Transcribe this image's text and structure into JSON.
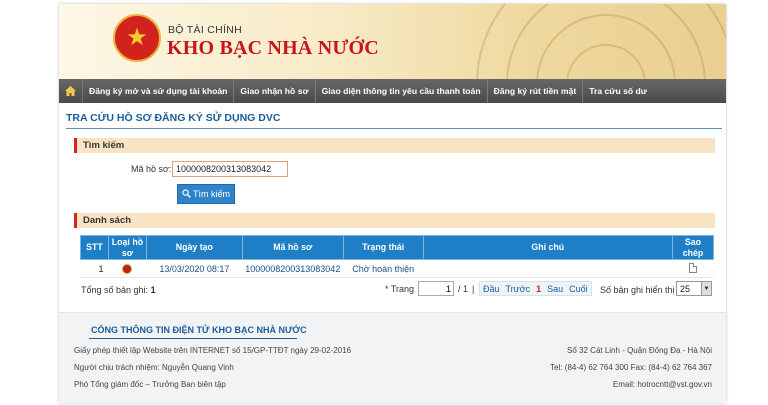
{
  "header": {
    "org_sub": "BỘ TÀI CHÍNH",
    "org_main": "KHO BẠC NHÀ NƯỚC",
    "brand_color": "#c8141b"
  },
  "nav": {
    "home_icon": "home-icon",
    "items": [
      {
        "label": "Đăng ký mở và sử dụng tài khoản"
      },
      {
        "label": "Giao nhận hồ sơ"
      },
      {
        "label": "Giao diện thông tin yêu cầu thanh toán"
      },
      {
        "label": "Đăng ký rút tiền mặt"
      },
      {
        "label": "Tra cứu số dư"
      }
    ]
  },
  "page": {
    "title": "TRA CỨU HỒ SƠ ĐĂNG KÝ SỬ DỤNG DVC"
  },
  "search": {
    "section_label": "Tìm kiếm",
    "field_label": "Mã hồ sơ:",
    "value": "1000008200313083042",
    "button_label": "Tìm kiếm"
  },
  "list": {
    "section_label": "Danh sách",
    "columns": [
      "STT",
      "Loại hồ sơ",
      "Ngày tạo",
      "Mã hồ sơ",
      "Trạng thái",
      "Ghi chú",
      "Sao chép"
    ],
    "rows": [
      {
        "stt": "1",
        "loai_icon": "record-type-icon",
        "ngay_tao": "13/03/2020 08:17",
        "ma_ho_so": "1000008200313083042",
        "trang_thai": "Chờ hoàn thiện",
        "ghi_chu": "",
        "sao_chep_icon": "copy-icon"
      }
    ],
    "total_label": "Tổng số bản ghi:",
    "total_value": "1"
  },
  "pager": {
    "page_label": "* Trang",
    "page_value": "1",
    "page_total": "/ 1",
    "separator": "|",
    "first": "Đầu",
    "prev": "Trước",
    "current": "1",
    "next": "Sau",
    "last": "Cuối",
    "rows_label": "Số bản ghi hiển thị",
    "rows_value": "25"
  },
  "footer": {
    "title": "CỔNG THÔNG TIN ĐIỆN TỬ KHO BẠC NHÀ NƯỚC",
    "left": [
      "Giấy phép thiết lập Website trên INTERNET số 15/GP-TTĐT ngày 29-02-2016",
      "Người chịu trách nhiệm: Nguyễn Quang Vinh",
      "Phó Tổng giám đốc – Trưởng Ban biên tập"
    ],
    "right": [
      "Số 32 Cát Linh - Quận Đống Đa - Hà Nội",
      "Tel: (84-4) 62 764 300 Fax: (84-4) 62 764 367",
      "Email: hotrocntt@vst.gov.vn"
    ]
  }
}
